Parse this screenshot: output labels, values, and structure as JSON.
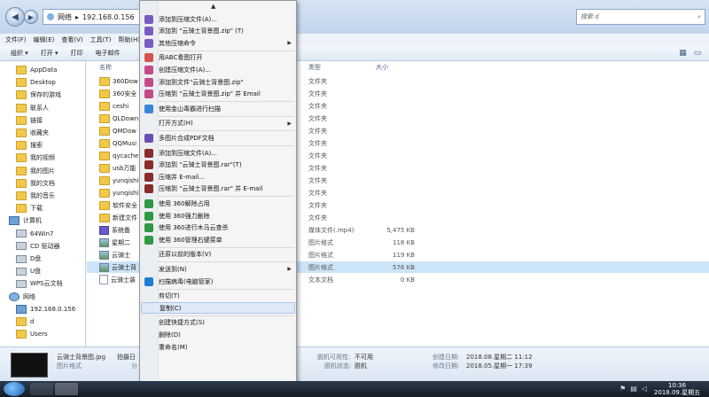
{
  "address": {
    "crumbs": [
      "网络",
      "192.168.0.156"
    ]
  },
  "search": {
    "placeholder": "搜索 d"
  },
  "menubar": [
    "文件(F)",
    "编辑(E)",
    "查看(V)",
    "工具(T)",
    "帮助(H)"
  ],
  "toolbar": {
    "organize": "组织 ▾",
    "open": "打开 ▾",
    "print": "打印",
    "email": "电子邮件"
  },
  "nav": [
    {
      "label": "AppData",
      "icon": "folder"
    },
    {
      "label": "Desktop",
      "icon": "folder"
    },
    {
      "label": "保存的游戏",
      "icon": "folder"
    },
    {
      "label": "联系人",
      "icon": "folder"
    },
    {
      "label": "链接",
      "icon": "folder"
    },
    {
      "label": "收藏夹",
      "icon": "folder"
    },
    {
      "label": "搜索",
      "icon": "folder"
    },
    {
      "label": "我的视频",
      "icon": "folder"
    },
    {
      "label": "我的图片",
      "icon": "folder"
    },
    {
      "label": "我的文档",
      "icon": "folder"
    },
    {
      "label": "我的音乐",
      "icon": "folder"
    },
    {
      "label": "下载",
      "icon": "folder"
    },
    {
      "label": "计算机",
      "icon": "pc"
    },
    {
      "label": "64Win7",
      "icon": "drive"
    },
    {
      "label": "CD 驱动器",
      "icon": "drive"
    },
    {
      "label": "D盘",
      "icon": "drive"
    },
    {
      "label": "U盘",
      "icon": "drive"
    },
    {
      "label": "WPS云文档",
      "icon": "drive"
    },
    {
      "label": "网络",
      "icon": "net"
    },
    {
      "label": "192.168.0.156",
      "icon": "pc"
    },
    {
      "label": "d",
      "icon": "folder"
    },
    {
      "label": "Users",
      "icon": "folder"
    }
  ],
  "columns": {
    "name": "名称",
    "type": "类型",
    "size": "大小"
  },
  "files": [
    {
      "name": "360Dow",
      "type": "文件夹",
      "size": "",
      "icon": "folder"
    },
    {
      "name": "360安全",
      "type": "文件夹",
      "size": "",
      "icon": "folder"
    },
    {
      "name": "ceshi",
      "type": "文件夹",
      "size": "",
      "icon": "folder"
    },
    {
      "name": "QLDown",
      "type": "文件夹",
      "size": "",
      "icon": "folder"
    },
    {
      "name": "QMDow",
      "type": "文件夹",
      "size": "",
      "icon": "folder"
    },
    {
      "name": "QQMusi",
      "type": "文件夹",
      "size": "",
      "icon": "folder"
    },
    {
      "name": "qycache",
      "type": "文件夹",
      "size": "",
      "icon": "folder"
    },
    {
      "name": "usb万能",
      "type": "文件夹",
      "size": "",
      "icon": "folder"
    },
    {
      "name": "yunqishi",
      "type": "文件夹",
      "size": "",
      "icon": "folder"
    },
    {
      "name": "yunqishi",
      "type": "文件夹",
      "size": "",
      "icon": "folder"
    },
    {
      "name": "软件安全",
      "type": "文件夹",
      "size": "",
      "icon": "folder"
    },
    {
      "name": "新建文件",
      "type": "文件夹",
      "size": "",
      "icon": "folder"
    },
    {
      "name": "系统备",
      "type": "媒体文件(.mp4)",
      "size": "5,475 KB",
      "icon": "video"
    },
    {
      "name": "星期二",
      "type": "图片格式",
      "size": "118 KB",
      "icon": "image"
    },
    {
      "name": "云骑士",
      "type": "图片格式",
      "size": "119 KB",
      "icon": "image"
    },
    {
      "name": "云骑士背",
      "type": "图片格式",
      "size": "576 KB",
      "icon": "image",
      "selected": true
    },
    {
      "name": "云骑士装",
      "type": "文本文档",
      "size": "0 KB",
      "icon": "file"
    }
  ],
  "details": {
    "filename": "云骑士背景图.jpg",
    "kind": "图片格式",
    "shot_label": "拍摄日",
    "share_label": "分",
    "offline_label": "脱机可用性:",
    "offline_value": "不可用",
    "offline_status_label": "脱机状态:",
    "offline_status_value": "脱机",
    "created_label": "创建日期:",
    "created_value": "2018.08.星期二 11:12",
    "modified_label": "修改日期:",
    "modified_value": "2018.05.星期一 17:39"
  },
  "context_menu": {
    "items": [
      {
        "label": "添加到压缩文件(A)...",
        "icon": "zip",
        "color": "#7a5cc2"
      },
      {
        "label": "添加到 \"云骑士背景图.zip\" (T)",
        "icon": "zip",
        "color": "#7a5cc2"
      },
      {
        "label": "其他压缩命令",
        "icon": "zip",
        "color": "#7a5cc2",
        "submenu": true
      },
      {
        "sep": true
      },
      {
        "label": "用ABC看图打开",
        "icon": "abc",
        "color": "#d9534f"
      },
      {
        "label": "创建压缩文件(A)...",
        "icon": "rar",
        "color": "#c44b8a"
      },
      {
        "label": "添加到文件\"云骑士背景图.zip\"",
        "icon": "rar",
        "color": "#c44b8a"
      },
      {
        "label": "压缩到 \"云骑士背景图.zip\" 并 Email",
        "icon": "rar",
        "color": "#c44b8a"
      },
      {
        "sep": true
      },
      {
        "label": "使用金山毒霸进行扫描",
        "icon": "shield",
        "color": "#3a86d6"
      },
      {
        "sep": true
      },
      {
        "label": "打开方式(H)",
        "icon": "none",
        "color": "",
        "submenu": true
      },
      {
        "sep": true
      },
      {
        "label": "多图片合成PDF文档",
        "icon": "pdf",
        "color": "#6a4fb5"
      },
      {
        "sep": true
      },
      {
        "label": "添加到压缩文件(A)...",
        "icon": "winrar",
        "color": "#8b2a2a"
      },
      {
        "label": "添加到 \"云骑士背景图.rar\"(T)",
        "icon": "winrar",
        "color": "#8b2a2a"
      },
      {
        "label": "压缩并 E-mail...",
        "icon": "winrar",
        "color": "#8b2a2a"
      },
      {
        "label": "压缩到 \"云骑士背景图.rar\" 并 E-mail",
        "icon": "winrar",
        "color": "#8b2a2a"
      },
      {
        "sep": true
      },
      {
        "label": "使用 360解除占用",
        "icon": "360",
        "color": "#2e9a45"
      },
      {
        "label": "使用 360强力删除",
        "icon": "360",
        "color": "#2e9a45"
      },
      {
        "label": "使用 360进行木马云查杀",
        "icon": "360",
        "color": "#2e9a45"
      },
      {
        "label": "使用 360管理右键菜单",
        "icon": "360",
        "color": "#2e9a45"
      },
      {
        "sep": true
      },
      {
        "label": "还原以前的版本(V)",
        "icon": "none",
        "color": ""
      },
      {
        "sep": true
      },
      {
        "label": "发送到(N)",
        "icon": "none",
        "color": "",
        "submenu": true
      },
      {
        "label": "扫描病毒(电脑管家)",
        "icon": "guard",
        "color": "#1f7ad6"
      },
      {
        "sep": true
      },
      {
        "label": "剪切(T)",
        "icon": "none",
        "color": ""
      },
      {
        "label": "复制(C)",
        "icon": "none",
        "color": "",
        "hover": true
      },
      {
        "sep": true
      },
      {
        "label": "创建快捷方式(S)",
        "icon": "none",
        "color": ""
      },
      {
        "label": "删除(D)",
        "icon": "none",
        "color": ""
      },
      {
        "label": "重命名(M)",
        "icon": "none",
        "color": ""
      }
    ]
  },
  "taskbar": {
    "clock_time": "10:36",
    "clock_date": "2018.09.星期五"
  }
}
